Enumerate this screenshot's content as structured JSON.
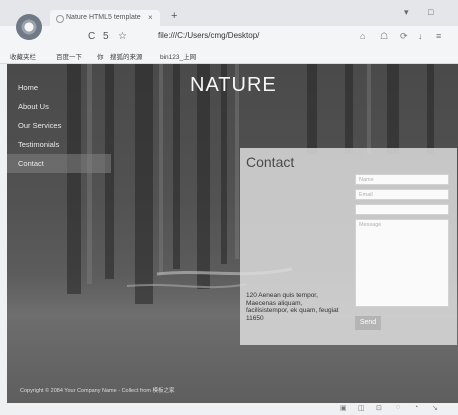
{
  "browser": {
    "tab_title": "Nature HTML5 template",
    "tab_close": "×",
    "new_tab": "+",
    "window_controls": [
      "▾",
      "□"
    ],
    "address": "file:///C:/Users/cmg/Desktop/",
    "nav": {
      "back": "C",
      "forward": "5",
      "star": "☆"
    },
    "toolbar_icons": [
      "⌂",
      "☖",
      "⟳",
      "↓",
      "≡"
    ],
    "bookmarks": [
      "收藏夹栏",
      "百度一下",
      "你",
      "搜狐的来源",
      "bin123_上网"
    ]
  },
  "page": {
    "site_title": "NATURE",
    "nav": [
      {
        "label": "Home",
        "active": false
      },
      {
        "label": "About Us",
        "active": false
      },
      {
        "label": "Our Services",
        "active": false
      },
      {
        "label": "Testimonials",
        "active": false
      },
      {
        "label": "Contact",
        "active": true
      }
    ],
    "contact": {
      "title": "Contact",
      "address": "120 Aenean quis tempor, Maecenas aliquam, facilisistempor, ek quam, feugiat 11650",
      "name_placeholder": "Name",
      "email_placeholder": "Email",
      "subject_placeholder": "",
      "message_placeholder": "Message",
      "send_label": "Send"
    },
    "footer": "Copyright © 2084 Your Company Name - Collect from 模板之家"
  },
  "colors": {
    "accent_panel": "#dedede",
    "nav_active": "#828282",
    "send_button": "#b4b4b4"
  }
}
